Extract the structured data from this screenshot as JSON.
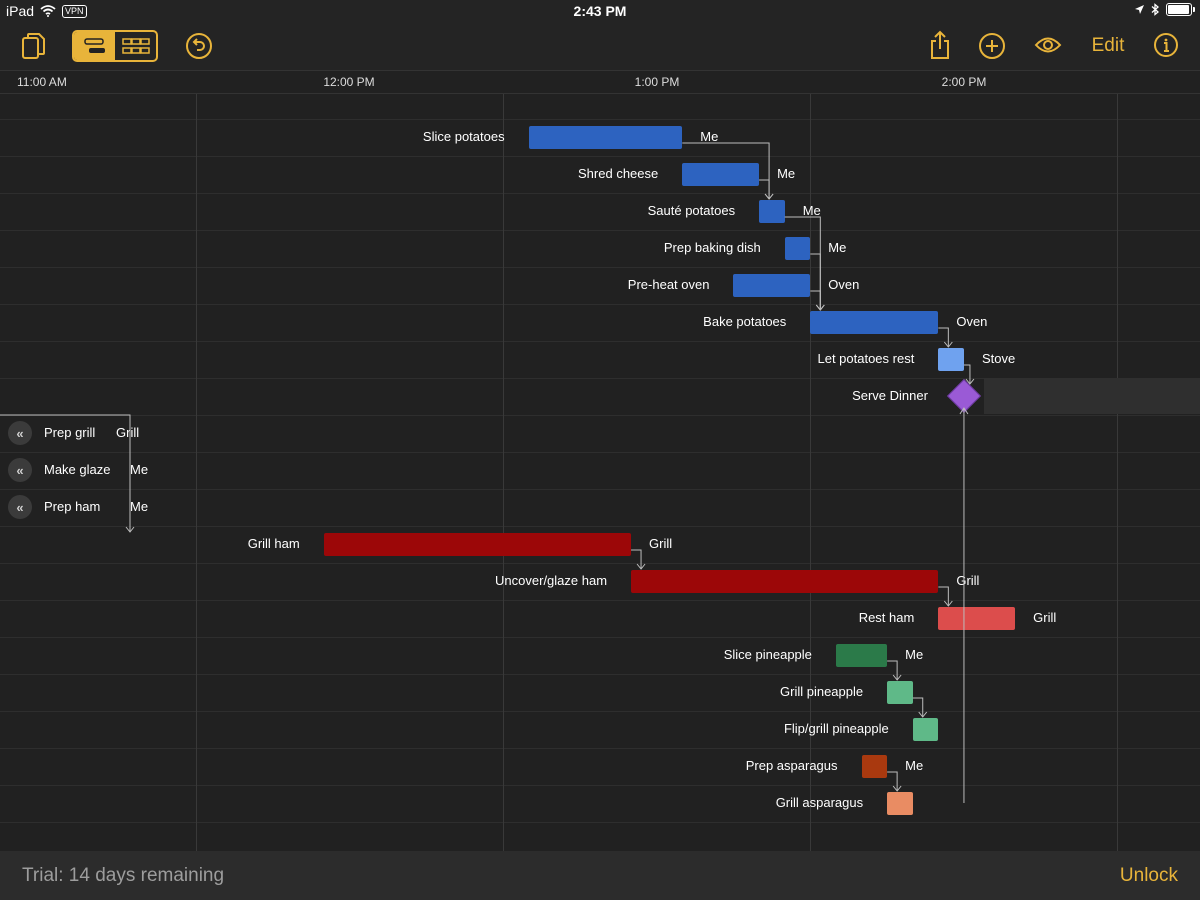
{
  "status_bar": {
    "device": "iPad",
    "vpn": "VPN",
    "time": "2:43 PM",
    "battery_fraction": 0.95
  },
  "toolbar": {
    "documents_icon": "documents-icon",
    "view_mode": "gantt",
    "gantt_icon": "gantt-view-icon",
    "grid_icon": "grid-view-icon",
    "undo_icon": "undo-icon",
    "share_icon": "share-icon",
    "add_icon": "plus-circle-icon",
    "view_icon": "eye-icon",
    "edit_label": "Edit",
    "info_icon": "info-icon"
  },
  "timeline": {
    "ticks": [
      "11:00 AM",
      "12:00 PM",
      "1:00 PM",
      "2:00 PM"
    ]
  },
  "colors": {
    "accent": "#e8b43a",
    "blue": "#2d63c0",
    "light_blue": "#6fa2ef",
    "purple": "#9a5ad6",
    "dark_red": "#9c0708",
    "red": "#dc4d4c",
    "dark_green": "#2b7a49",
    "green": "#5fb988",
    "brown_orange": "#a9390f",
    "salmon": "#e98c63"
  },
  "tasks": [
    {
      "name": "Slice potatoes",
      "start": "12:05 PM",
      "end": "12:35 PM",
      "resource": "Me",
      "color": "#2d63c0"
    },
    {
      "name": "Shred cheese",
      "start": "12:35 PM",
      "end": "12:50 PM",
      "resource": "Me",
      "color": "#2d63c0"
    },
    {
      "name": "Sauté potatoes",
      "start": "12:50 PM",
      "end": "12:55 PM",
      "resource": "Me",
      "color": "#2d63c0"
    },
    {
      "name": "Prep baking dish",
      "start": "12:55 PM",
      "end": "1:00 PM",
      "resource": "Me",
      "color": "#2d63c0"
    },
    {
      "name": "Pre-heat oven",
      "start": "12:45 PM",
      "end": "1:00 PM",
      "resource": "Oven",
      "color": "#2d63c0"
    },
    {
      "name": "Bake potatoes",
      "start": "1:00 PM",
      "end": "1:25 PM",
      "resource": "Oven",
      "color": "#2d63c0"
    },
    {
      "name": "Let potatoes rest",
      "start": "1:25 PM",
      "end": "1:30 PM",
      "resource": "Stove",
      "color": "#6fa2ef"
    },
    {
      "name": "Serve Dinner",
      "start": "1:30 PM",
      "end": "1:30 PM",
      "resource": "",
      "milestone": true,
      "color": "#9a5ad6"
    },
    {
      "name": "Prep grill",
      "resource": "Grill",
      "offscreen": true
    },
    {
      "name": "Make glaze",
      "resource": "Me",
      "offscreen": true
    },
    {
      "name": "Prep ham",
      "resource": "Me",
      "offscreen": true
    },
    {
      "name": "Grill ham",
      "start": "11:25 AM",
      "end": "12:25 PM",
      "resource": "Grill",
      "color": "#9c0708"
    },
    {
      "name": "Uncover/glaze ham",
      "start": "12:25 PM",
      "end": "1:25 PM",
      "resource": "Grill",
      "color": "#9c0708"
    },
    {
      "name": "Rest ham",
      "start": "1:25 PM",
      "end": "1:40 PM",
      "resource": "Grill",
      "color": "#dc4d4c"
    },
    {
      "name": "Slice pineapple",
      "start": "1:05 PM",
      "end": "1:15 PM",
      "resource": "Me",
      "color": "#2b7a49"
    },
    {
      "name": "Grill pineapple",
      "start": "1:15 PM",
      "end": "1:20 PM",
      "resource": "",
      "color": "#5fb988"
    },
    {
      "name": "Flip/grill pineapple",
      "start": "1:20 PM",
      "end": "1:25 PM",
      "resource": "",
      "color": "#5fb988"
    },
    {
      "name": "Prep asparagus",
      "start": "1:10 PM",
      "end": "1:15 PM",
      "resource": "Me",
      "color": "#a9390f"
    },
    {
      "name": "Grill asparagus",
      "start": "1:15 PM",
      "end": "1:20 PM",
      "resource": "",
      "color": "#e98c63"
    }
  ],
  "offscreen_icon": "chevrons-left-icon",
  "footer": {
    "trial_text": "Trial: 14 days remaining",
    "unlock_label": "Unlock"
  }
}
